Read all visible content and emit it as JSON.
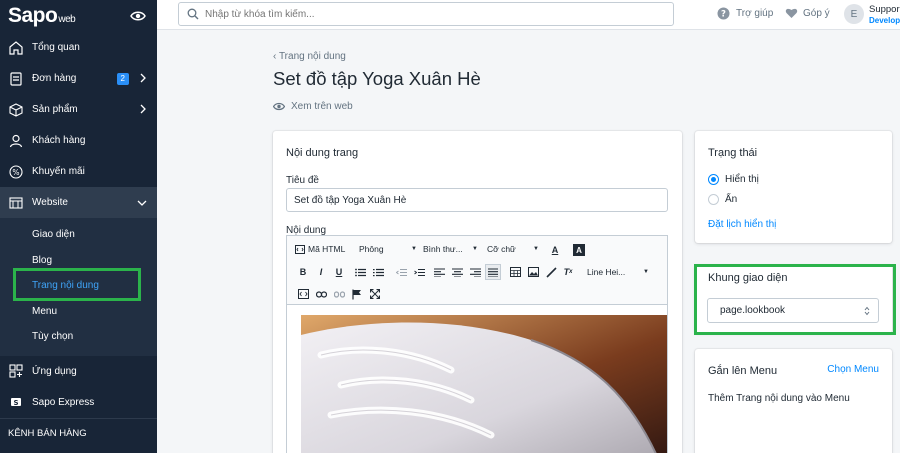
{
  "sidebar": {
    "logo": "Sapo",
    "logo_suffix": "web",
    "items": [
      {
        "label": "Tổng quan",
        "icon": "home-icon"
      },
      {
        "label": "Đơn hàng",
        "icon": "order-icon",
        "badge": "2"
      },
      {
        "label": "Sản phẩm",
        "icon": "box-icon"
      },
      {
        "label": "Khách hàng",
        "icon": "user-icon"
      },
      {
        "label": "Khuyến mãi",
        "icon": "percent-icon"
      },
      {
        "label": "Website",
        "icon": "website-icon"
      }
    ],
    "website_sub": [
      "Giao diện",
      "Blog",
      "Trang nội dung",
      "Menu",
      "Tùy chọn"
    ],
    "bottom_items": [
      {
        "label": "Ứng dụng",
        "icon": "apps-icon"
      },
      {
        "label": "Sapo Express",
        "icon": "sapo-express-icon"
      }
    ],
    "section_label": "KÊNH BÁN HÀNG"
  },
  "topbar": {
    "search_placeholder": "Nhập từ khóa tìm kiếm...",
    "help": "Trợ giúp",
    "feedback": "Góp ý",
    "avatar_letter": "E",
    "user_name": "Suppor",
    "user_role": "Develop"
  },
  "page": {
    "back_link": "Trang nội dung",
    "title": "Set đồ tập Yoga Xuân Hè",
    "view_on_web": "Xem trên web"
  },
  "content_card": {
    "title": "Nội dung trang",
    "title_label": "Tiêu đề",
    "title_value": "Set đồ tập Yoga Xuân Hè",
    "content_label": "Nội dung",
    "toolbar": {
      "html": "Mã HTML",
      "font": "Phông",
      "format": "Bình thư...",
      "size": "Cỡ chữ",
      "line_height": "Line Hei..."
    }
  },
  "status_card": {
    "title": "Trạng thái",
    "option_visible": "Hiển thị",
    "option_hidden": "Ẩn",
    "schedule_link": "Đặt lịch hiển thị"
  },
  "template_card": {
    "title": "Khung giao diện",
    "selected": "page.lookbook"
  },
  "menu_card": {
    "title": "Gắn lên Menu",
    "link": "Chọn Menu",
    "text": "Thêm Trang nội dung vào Menu"
  },
  "colors": {
    "sidebar_bg": "#182537",
    "accent": "#0088ff",
    "highlight": "#2bb34b"
  }
}
